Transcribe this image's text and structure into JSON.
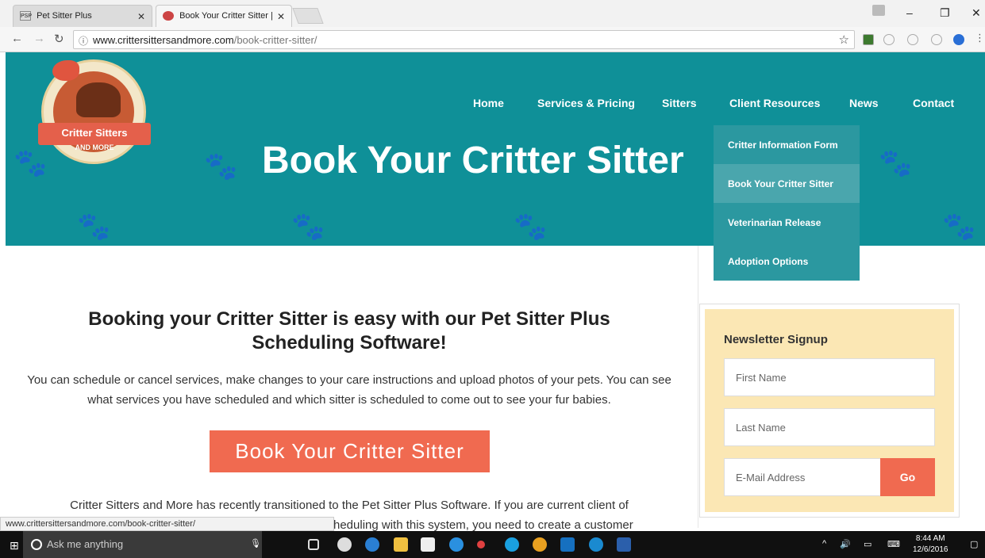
{
  "browser": {
    "tabs": [
      {
        "label": "Pet Sitter Plus",
        "favicon": "PSP"
      },
      {
        "label": "Book Your Critter Sitter |"
      }
    ],
    "url_host": "www.crittersittersandmore.com",
    "url_path": "/book-critter-sitter/",
    "status_url": "www.crittersittersandmore.com/book-critter-sitter/"
  },
  "site": {
    "logo": {
      "line1": "Critter Sitters",
      "line2": "AND MORE"
    },
    "nav": [
      "Home",
      "Services & Pricing",
      "Sitters",
      "Client Resources",
      "News",
      "Contact"
    ],
    "hero_title": "Book Your Critter Sitter",
    "dropdown": [
      "Critter Information Form",
      "Book Your Critter Sitter",
      "Veterinarian Release",
      "Adoption Options"
    ],
    "heading_line1": "Booking your Critter Sitter is easy with  our Pet Sitter Plus",
    "heading_line2": "Scheduling Software!",
    "paragraph": "You can schedule or cancel services, make changes to your care instructions and upload photos of your pets. You can see what services you have scheduled and which sitter is scheduled to come out to see your fur babies.",
    "cta_label": "Book Your Critter Sitter",
    "paragraph2_line1": "Critter Sitters and More has recently transitioned to the Pet Sitter Plus Software. If you are current client of",
    "paragraph2_line2": "heduling with this system,  you need to create a customer"
  },
  "newsletter": {
    "title": "Newsletter Signup",
    "first_name_placeholder": "First Name",
    "last_name_placeholder": "Last Name",
    "email_placeholder": "E-Mail Address",
    "go_label": "Go"
  },
  "taskbar": {
    "search_placeholder": "Ask me anything",
    "time": "8:44 AM",
    "date": "12/6/2016"
  },
  "colors": {
    "hero": "#0f9098",
    "dropdown": "#2b98a0",
    "accent": "#f06a50",
    "newsletter_bg": "#fbe7b4"
  }
}
